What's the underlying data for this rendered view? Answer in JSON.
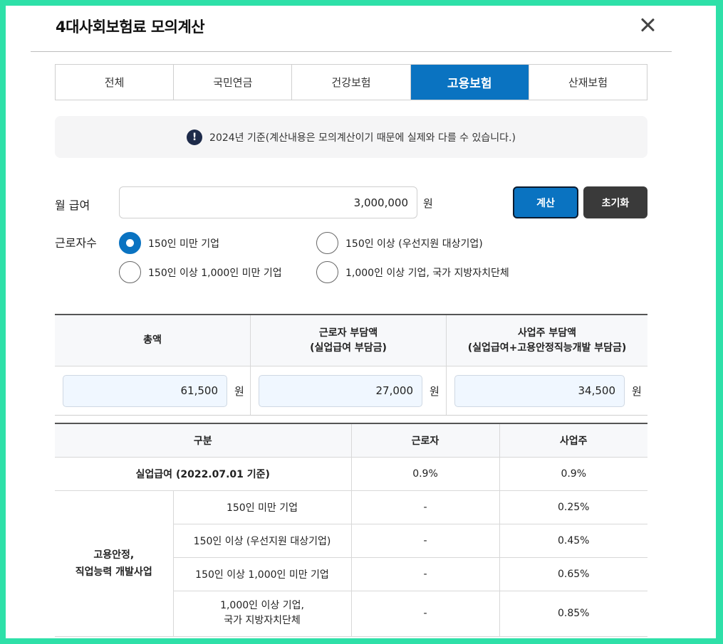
{
  "dialog": {
    "title": "4대사회보험료 모의계산",
    "tabs": [
      {
        "label": "전체",
        "active": false
      },
      {
        "label": "국민연금",
        "active": false
      },
      {
        "label": "건강보험",
        "active": false
      },
      {
        "label": "고용보험",
        "active": true
      },
      {
        "label": "산재보험",
        "active": false
      }
    ],
    "notice": "2024년 기준(계산내용은 모의계산이기 때문에 실제와 다를 수 있습니다.)",
    "notice_icon": "!"
  },
  "form": {
    "salary_label": "월 급여",
    "salary_value": "3,000,000",
    "unit": "원",
    "calc_label": "계산",
    "reset_label": "초기화",
    "workers_label": "근로자수",
    "options": [
      {
        "label": "150인 미만 기업",
        "checked": true
      },
      {
        "label": "150인 이상 (우선지원 대상기업)",
        "checked": false
      },
      {
        "label": "150인 이상 1,000인 미만 기업",
        "checked": false
      },
      {
        "label": "1,000인 이상 기업, 국가 지방자치단체",
        "checked": false
      }
    ]
  },
  "result": {
    "headers": [
      {
        "line1": "총액",
        "line2": ""
      },
      {
        "line1": "근로자 부담액",
        "line2": "(실업급여 부담금)"
      },
      {
        "line1": "사업주 부담액",
        "line2": "(실업급여+고용안정직능개발 부담금)"
      }
    ],
    "values": [
      "61,500",
      "27,000",
      "34,500"
    ],
    "unit": "원"
  },
  "rates": {
    "headers": [
      "구분",
      "근로자",
      "사업주"
    ],
    "unemployment": {
      "label": "실업급여 (2022.07.01 기준)",
      "worker": "0.9%",
      "employer": "0.9%"
    },
    "group_label_1": "고용안정,",
    "group_label_2": "직업능력 개발사업",
    "rows": [
      {
        "label1": "150인 미만 기업",
        "label2": "",
        "worker": "-",
        "employer": "0.25%"
      },
      {
        "label1": "150인 이상 (우선지원 대상기업)",
        "label2": "",
        "worker": "-",
        "employer": "0.45%"
      },
      {
        "label1": "150인 이상 1,000인 미만 기업",
        "label2": "",
        "worker": "-",
        "employer": "0.65%"
      },
      {
        "label1": "1,000인 이상 기업,",
        "label2": "국가 지방자치단체",
        "worker": "-",
        "employer": "0.85%"
      }
    ]
  },
  "colors": {
    "accent": "#0a73c1",
    "frame": "#2ee0a8",
    "reset": "#3a3a3a"
  }
}
